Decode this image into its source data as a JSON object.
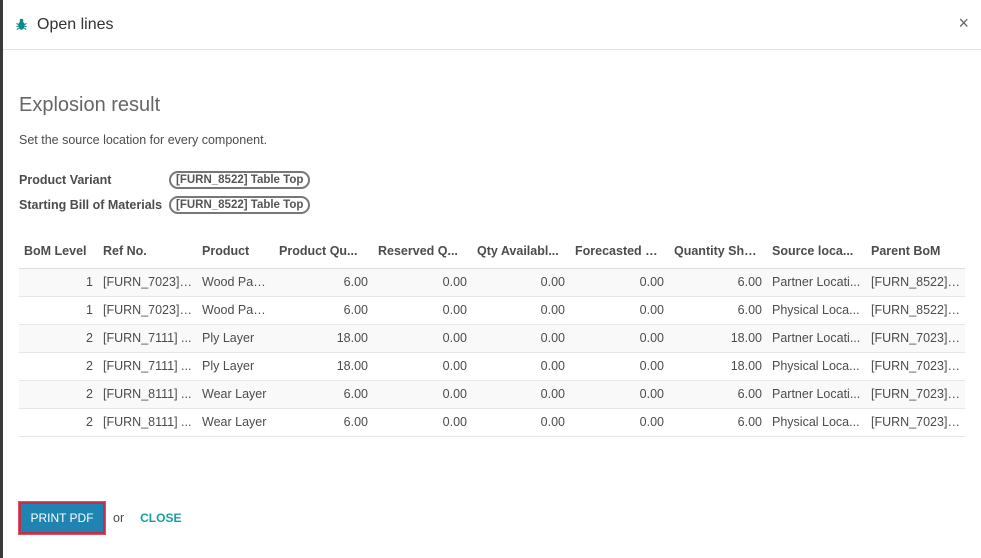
{
  "dialog": {
    "title": "Open lines",
    "close_glyph": "×",
    "icon": "bug-icon",
    "icon_color": "#0f8a88"
  },
  "body": {
    "heading": "Explosion result",
    "subtitle": "Set the source location for every component.",
    "fields": [
      {
        "label": "Product Variant",
        "value": "[FURN_8522] Table Top"
      },
      {
        "label": "Starting Bill of Materials",
        "value": "[FURN_8522] Table Top"
      }
    ]
  },
  "table": {
    "columns": [
      "BoM Level",
      "Ref No.",
      "Product",
      "Product Qu...",
      "Reserved Q...",
      "Qty Availabl...",
      "Forecasted Q...",
      "Quantity Shor...",
      "Source loca...",
      "Parent BoM"
    ],
    "rows": [
      [
        "1",
        "[FURN_7023] ...",
        "Wood Panel",
        "6.00",
        "0.00",
        "0.00",
        "0.00",
        "6.00",
        "Partner Locati...",
        "[FURN_8522] ..."
      ],
      [
        "1",
        "[FURN_7023] ...",
        "Wood Panel",
        "6.00",
        "0.00",
        "0.00",
        "0.00",
        "6.00",
        "Physical Loca...",
        "[FURN_8522] ..."
      ],
      [
        "2",
        "[FURN_7111] ...",
        "Ply Layer",
        "18.00",
        "0.00",
        "0.00",
        "0.00",
        "18.00",
        "Partner Locati...",
        "[FURN_7023] ..."
      ],
      [
        "2",
        "[FURN_7111] ...",
        "Ply Layer",
        "18.00",
        "0.00",
        "0.00",
        "0.00",
        "18.00",
        "Physical Loca...",
        "[FURN_7023] ..."
      ],
      [
        "2",
        "[FURN_8111] ...",
        "Wear Layer",
        "6.00",
        "0.00",
        "0.00",
        "0.00",
        "6.00",
        "Partner Locati...",
        "[FURN_7023] ..."
      ],
      [
        "2",
        "[FURN_8111] ...",
        "Wear Layer",
        "6.00",
        "0.00",
        "0.00",
        "0.00",
        "6.00",
        "Physical Loca...",
        "[FURN_7023] ..."
      ]
    ]
  },
  "footer": {
    "print_label": "PRINT PDF",
    "or_text": "or",
    "close_label": "CLOSE"
  },
  "colors": {
    "primary": "#1f84b2",
    "accent": "#18a1a1",
    "focus_border": "#c0304a"
  }
}
